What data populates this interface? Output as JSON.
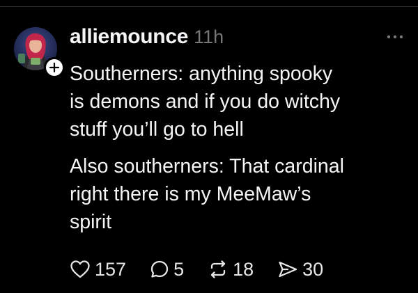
{
  "post": {
    "author": {
      "username": "alliemounce",
      "avatar_icon": "profile-photo",
      "follow_icon": "plus-icon"
    },
    "timestamp": "11h",
    "more_icon": "ellipsis-icon",
    "paragraphs": [
      {
        "lines": [
          "Southerners: anything spooky",
          "is demons and if you do witchy",
          "stuff you’ll go to hell"
        ]
      },
      {
        "lines": [
          "Also southerners: That cardinal",
          "right there is my MeeMaw’s",
          "spirit"
        ]
      }
    ],
    "actions": {
      "likes": "157",
      "replies": "5",
      "reposts": "18",
      "shares": "30"
    }
  },
  "colors": {
    "background": "#000000",
    "text_primary": "#f3f5f7",
    "text_secondary": "#777777",
    "icon": "#e6e6e6"
  }
}
